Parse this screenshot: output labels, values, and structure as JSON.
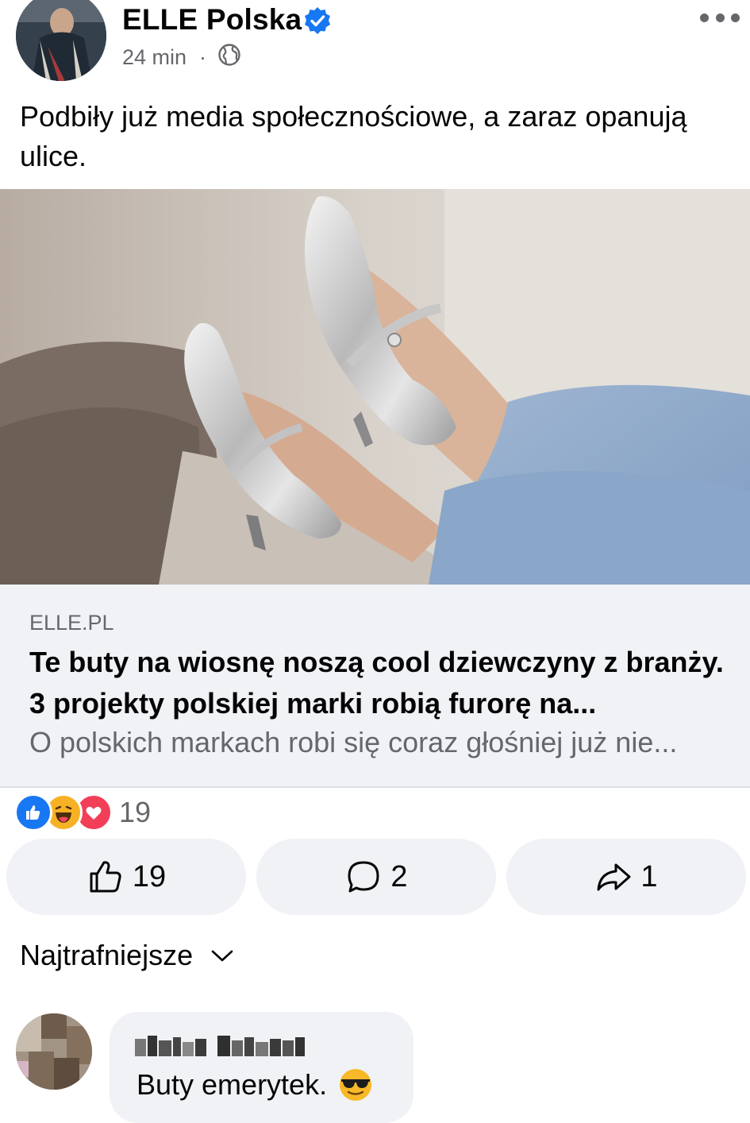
{
  "post": {
    "author": "ELLE Polska",
    "verified": true,
    "time": "24 min",
    "separator": "·",
    "audience_icon": "globe-icon",
    "text": "Podbiły już media społecznościowe, a zaraz opanują ulice."
  },
  "link_preview": {
    "domain": "ELLE.PL",
    "title": "Te buty na wiosnę noszą cool dziewczyny z branży. 3 projekty polskiej marki robią furorę na...",
    "description": "O polskich markach robi się coraz głośniej już nie..."
  },
  "reactions": {
    "icons": [
      "like-reaction-icon",
      "haha-reaction-icon",
      "love-reaction-icon"
    ],
    "count": "19"
  },
  "actions": {
    "like_count": "19",
    "comment_count": "2",
    "share_count": "1"
  },
  "comments": {
    "sort_label": "Najtrafniejsze",
    "items": [
      {
        "text": "Buty emerytek.",
        "emoji_icon": "sunglasses-emoji-icon"
      }
    ]
  },
  "colors": {
    "accent": "#1877f2",
    "secondary_text": "#65676b",
    "button_bg": "#f0f2f5",
    "love": "#f33e58",
    "haha": "#f7b125"
  }
}
